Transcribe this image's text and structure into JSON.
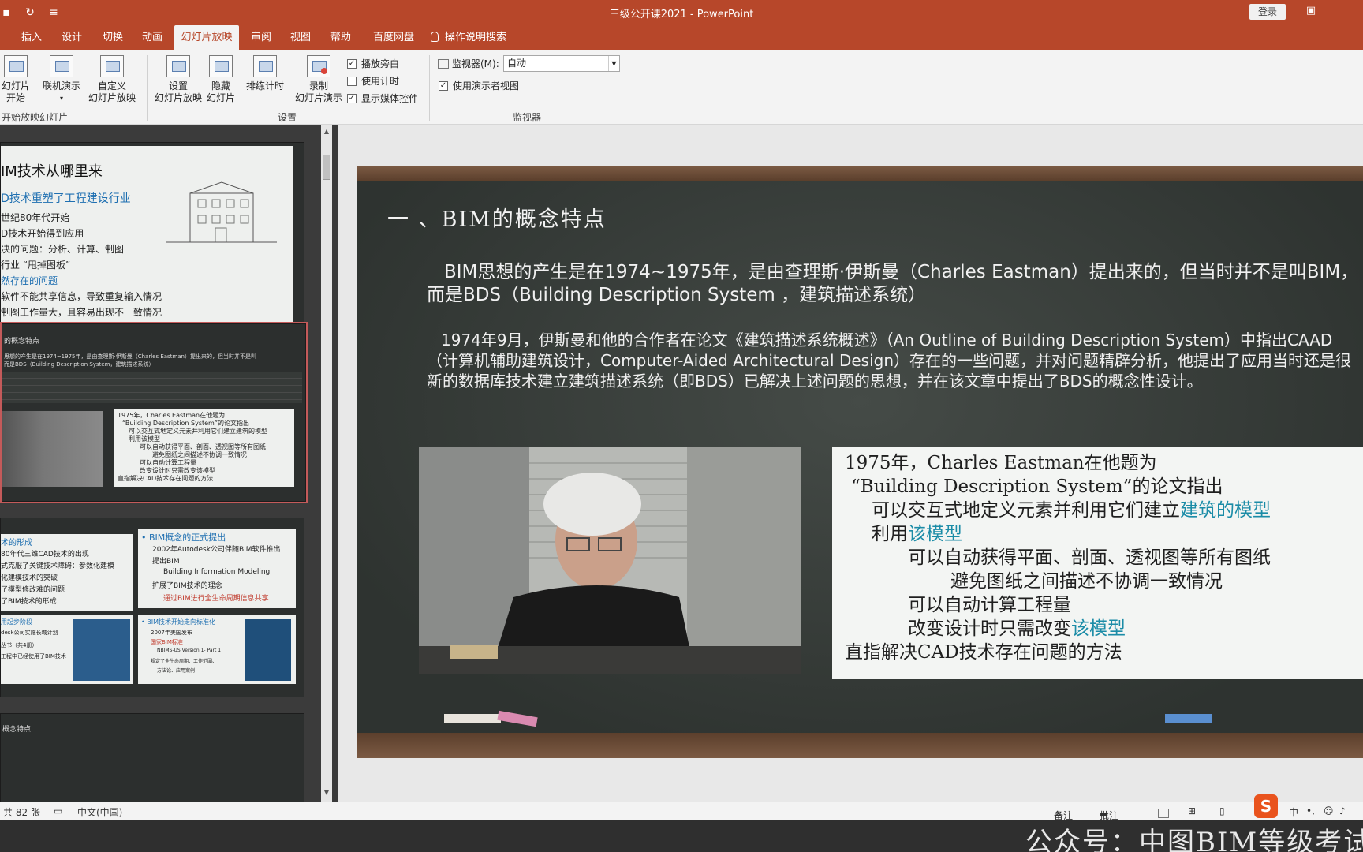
{
  "window": {
    "title": "三级公开课2021  -  PowerPoint",
    "login_label": "登录"
  },
  "tabs": [
    {
      "label": "插入"
    },
    {
      "label": "设计"
    },
    {
      "label": "切换"
    },
    {
      "label": "动画"
    },
    {
      "label": "幻灯片放映"
    },
    {
      "label": "审阅"
    },
    {
      "label": "视图"
    },
    {
      "label": "帮助"
    },
    {
      "label": "百度网盘"
    }
  ],
  "tell_me": "操作说明搜索",
  "ribbon": {
    "from_start": {
      "line1": "幻灯片",
      "line2": "开始"
    },
    "online": {
      "line1": "联机演示"
    },
    "custom": {
      "line1": "自定义",
      "line2": "幻灯片放映"
    },
    "group_start": "开始放映幻灯片",
    "setup": {
      "line1": "设置",
      "line2": "幻灯片放映"
    },
    "hide": {
      "line1": "隐藏",
      "line2": "幻灯片"
    },
    "rehearse": {
      "line1": "排练计时"
    },
    "record": {
      "line1": "录制",
      "line2": "幻灯片演示"
    },
    "chk_narration": "播放旁白",
    "chk_timing": "使用计时",
    "chk_media": "显示媒体控件",
    "group_setup": "设置",
    "monitor_label": "监视器(M):",
    "monitor_value": "自动",
    "chk_presenter": "使用演示者视图",
    "group_monitor": "监视器"
  },
  "thumbnails": {
    "t1": {
      "title": "IM技术从哪里来",
      "lines": [
        "D技术重塑了工程建设行业",
        "世纪80年代开始",
        "D技术开始得到应用",
        "决的问题：分析、计算、制图",
        "行业 “甩掉图板”",
        "然存在的问题",
        "软件不能共享信息，导致重复输入情况",
        "制图工作量大，且容易出现不一致情况"
      ]
    },
    "t2": {
      "title": "的概念特点",
      "l1": "思想的产生是在1974~1975年，是由查理斯·伊斯曼（Charles Eastman）提出来的，但当时并不是叫",
      "l2": "而是BDS（Building Description System，建筑描述系统）",
      "box": [
        "1975年，Charles Eastman在他题为",
        "“Building Description System”的论文指出",
        "可以交互式地定义元素并利用它们建立建筑的模型",
        "利用该模型",
        "可以自动获得平面、剖面、透视图等所有图纸",
        "避免图纸之间描述不协调一致情况",
        "可以自动计算工程量",
        "改变设计时只需改变该模型",
        "直指解决CAD技术存在问题的方法"
      ]
    },
    "t3": {
      "left": [
        "术的形成",
        "80年代三维CAD技术的出现",
        "式克服了关键技术障碍：参数化建模",
        "化建模技术的突破",
        "了模型修改难的问题",
        "了BIM技术的形成"
      ],
      "right_title": "• BIM概念的正式提出",
      "right": [
        "2002年Autodesk公司伴随BIM软件推出",
        "提出BIM",
        "Building Information Modeling",
        "扩展了BIM技术的理念",
        "通过BIM进行全生命周期信息共享"
      ],
      "bl": [
        "用起步阶段",
        "desk公司实施长城计划",
        "丛书（共4册）",
        "工程中已经使用了BIM技术"
      ],
      "br": [
        "• BIM技术开始走向标准化",
        "2007年美国发布",
        "国家BIM标准",
        "NBIMS-US Version 1- Part 1",
        "规定了全生命周期、工作范围、",
        "方法论、应用案例"
      ]
    },
    "t4_title": "概念特点"
  },
  "slide": {
    "heading": "一 、BIM的概念特点",
    "para1": "BIM思想的产生是在1974~1975年，是由查理斯·伊斯曼（Charles Eastman）提出来的，但当时并不是叫BIM，而是BDS（Building Description System ，建筑描述系统）",
    "para2": "1974年9月，伊斯曼和他的合作者在论文《建筑描述系统概述》（An Outline of Building Description System）中指出CAAD（计算机辅助建筑设计，Computer-Aided Architectural Design）存在的一些问题，并对问题精辟分析，他提出了应用当时还是很新的数据库技术建立建筑描述系统（即BDS）已解决上述问题的思想，并在该文章中提出了BDS的概念性设计。",
    "box": {
      "l1": "1975年，Charles Eastman在他题为",
      "l2": "“Building Description System”的论文指出",
      "l3a": "可以交互式地定义元素并利用它们建立",
      "l3b": "建筑的模型",
      "l4a": "利用",
      "l4b": "该模型",
      "l5": "可以自动获得平面、剖面、透视图等所有图纸",
      "l6": "避免图纸之间描述不协调一致情况",
      "l7": "可以自动计算工程量",
      "l8a": "改变设计时只需改变",
      "l8b": "该模型",
      "l9": "直指解决CAD技术存在问题的方法"
    }
  },
  "statusbar": {
    "slide_count": "共 82 张",
    "language": "中文(中国)",
    "notes": "备注",
    "comments": "批注",
    "ime": "中"
  },
  "watermark": "公众号：中图BIM等级考试"
}
